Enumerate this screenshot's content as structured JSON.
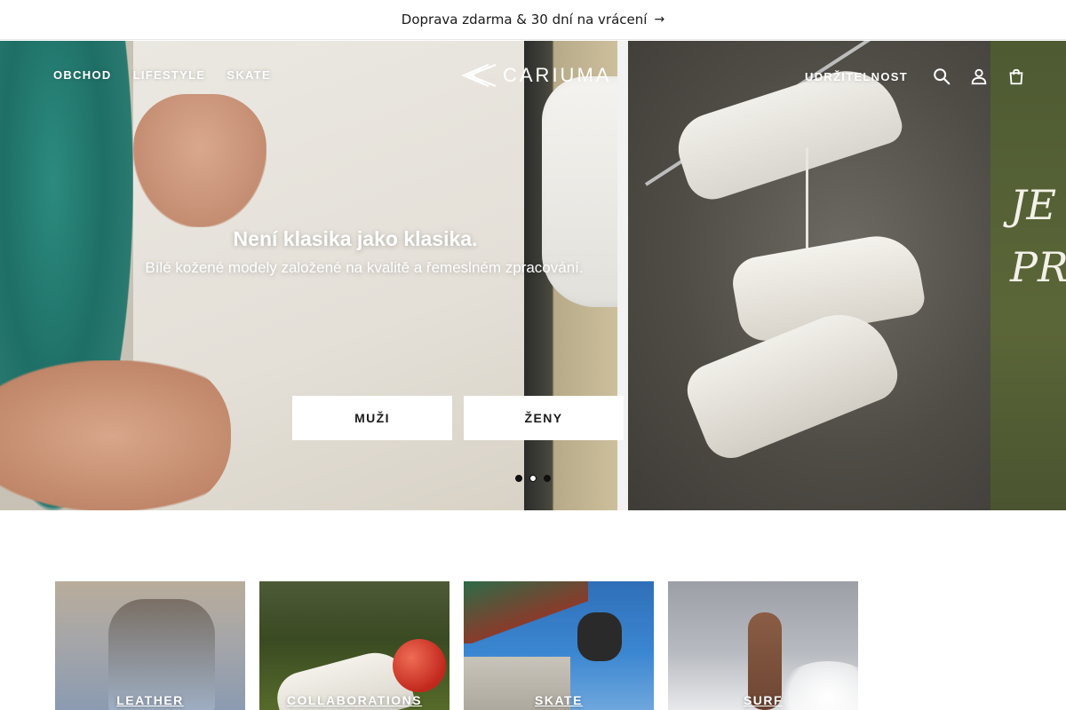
{
  "announcement": {
    "text": "Doprava zdarma & 30 dní na vrácení",
    "arrow": "→"
  },
  "header": {
    "nav_left": [
      "OBCHOD",
      "LIFESTYLE",
      "SKATE"
    ],
    "logo_text": "CARIUMA",
    "nav_right": [
      "UDRŽITELNOST"
    ],
    "icons": [
      "search-icon",
      "account-icon",
      "cart-icon"
    ]
  },
  "hero": {
    "title": "Není klasika jako klasika.",
    "subtitle": "Bílé kožené modely založené na kvalitě a řemeslném zpracování.",
    "buttons": [
      "MUŽI",
      "ŽENY"
    ],
    "slide_count": 3,
    "active_slide": 1,
    "side_text": "JE PR"
  },
  "categories": [
    {
      "label": "LEATHER"
    },
    {
      "label": "COLLABORATIONS"
    },
    {
      "label": "SKATE"
    },
    {
      "label": "SURF"
    }
  ]
}
